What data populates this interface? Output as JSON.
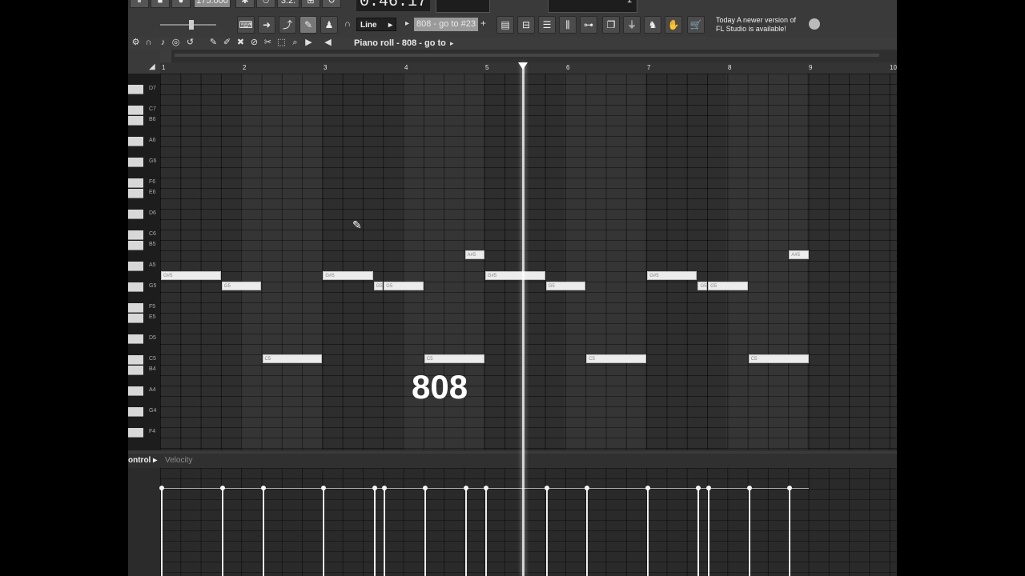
{
  "toolbar": {
    "tempo": "175.000",
    "counter": "3:2:",
    "time": "0:46:17",
    "snap_mode": "Line",
    "pattern_name": "808 - go to #23",
    "channel_count": "1",
    "notice": "Today  A newer version of FL Studio is available!"
  },
  "piano_roll": {
    "title": "Piano roll - 808 - go to"
  },
  "ruler": {
    "bars": [
      "1",
      "2",
      "3",
      "4",
      "5",
      "6",
      "7",
      "8",
      "9",
      "10"
    ]
  },
  "keyboard": {
    "labels": [
      "D7",
      "C7",
      "B6",
      "A6",
      "G6",
      "F6",
      "E6",
      "D6",
      "C6",
      "B5",
      "A5",
      "G5",
      "F5",
      "E5",
      "D5",
      "C5",
      "B4",
      "A4",
      "G4",
      "F4"
    ]
  },
  "notes": [
    {
      "label": "G#5",
      "start": 1.0,
      "length": 0.75,
      "pitch": "G#5"
    },
    {
      "label": "G5",
      "start": 1.75,
      "length": 0.5,
      "pitch": "G5"
    },
    {
      "label": "C5",
      "start": 2.25,
      "length": 0.75,
      "pitch": "C5"
    },
    {
      "label": "G#5",
      "start": 3.0,
      "length": 0.625,
      "pitch": "G#5"
    },
    {
      "label": "G5",
      "start": 3.625,
      "length": 0.125,
      "pitch": "G5"
    },
    {
      "label": "G5",
      "start": 3.75,
      "length": 0.5,
      "pitch": "G5"
    },
    {
      "label": "C5",
      "start": 4.25,
      "length": 0.75,
      "pitch": "C5"
    },
    {
      "label": "A#5",
      "start": 4.75,
      "length": 0.25,
      "pitch": "A#5"
    },
    {
      "label": "G#5",
      "start": 5.0,
      "length": 0.75,
      "pitch": "G#5"
    },
    {
      "label": "G5",
      "start": 5.75,
      "length": 0.5,
      "pitch": "G5"
    },
    {
      "label": "C5",
      "start": 6.25,
      "length": 0.75,
      "pitch": "C5"
    },
    {
      "label": "G#5",
      "start": 7.0,
      "length": 0.625,
      "pitch": "G#5"
    },
    {
      "label": "G5",
      "start": 7.625,
      "length": 0.125,
      "pitch": "G5"
    },
    {
      "label": "G5",
      "start": 7.75,
      "length": 0.5,
      "pitch": "G5"
    },
    {
      "label": "C5",
      "start": 8.25,
      "length": 0.75,
      "pitch": "C5"
    },
    {
      "label": "A#5",
      "start": 8.75,
      "length": 0.25,
      "pitch": "A#5"
    }
  ],
  "overlay_text": "808",
  "event_editor": {
    "control_label": "ontrol ▸",
    "target_label": "Velocity"
  }
}
